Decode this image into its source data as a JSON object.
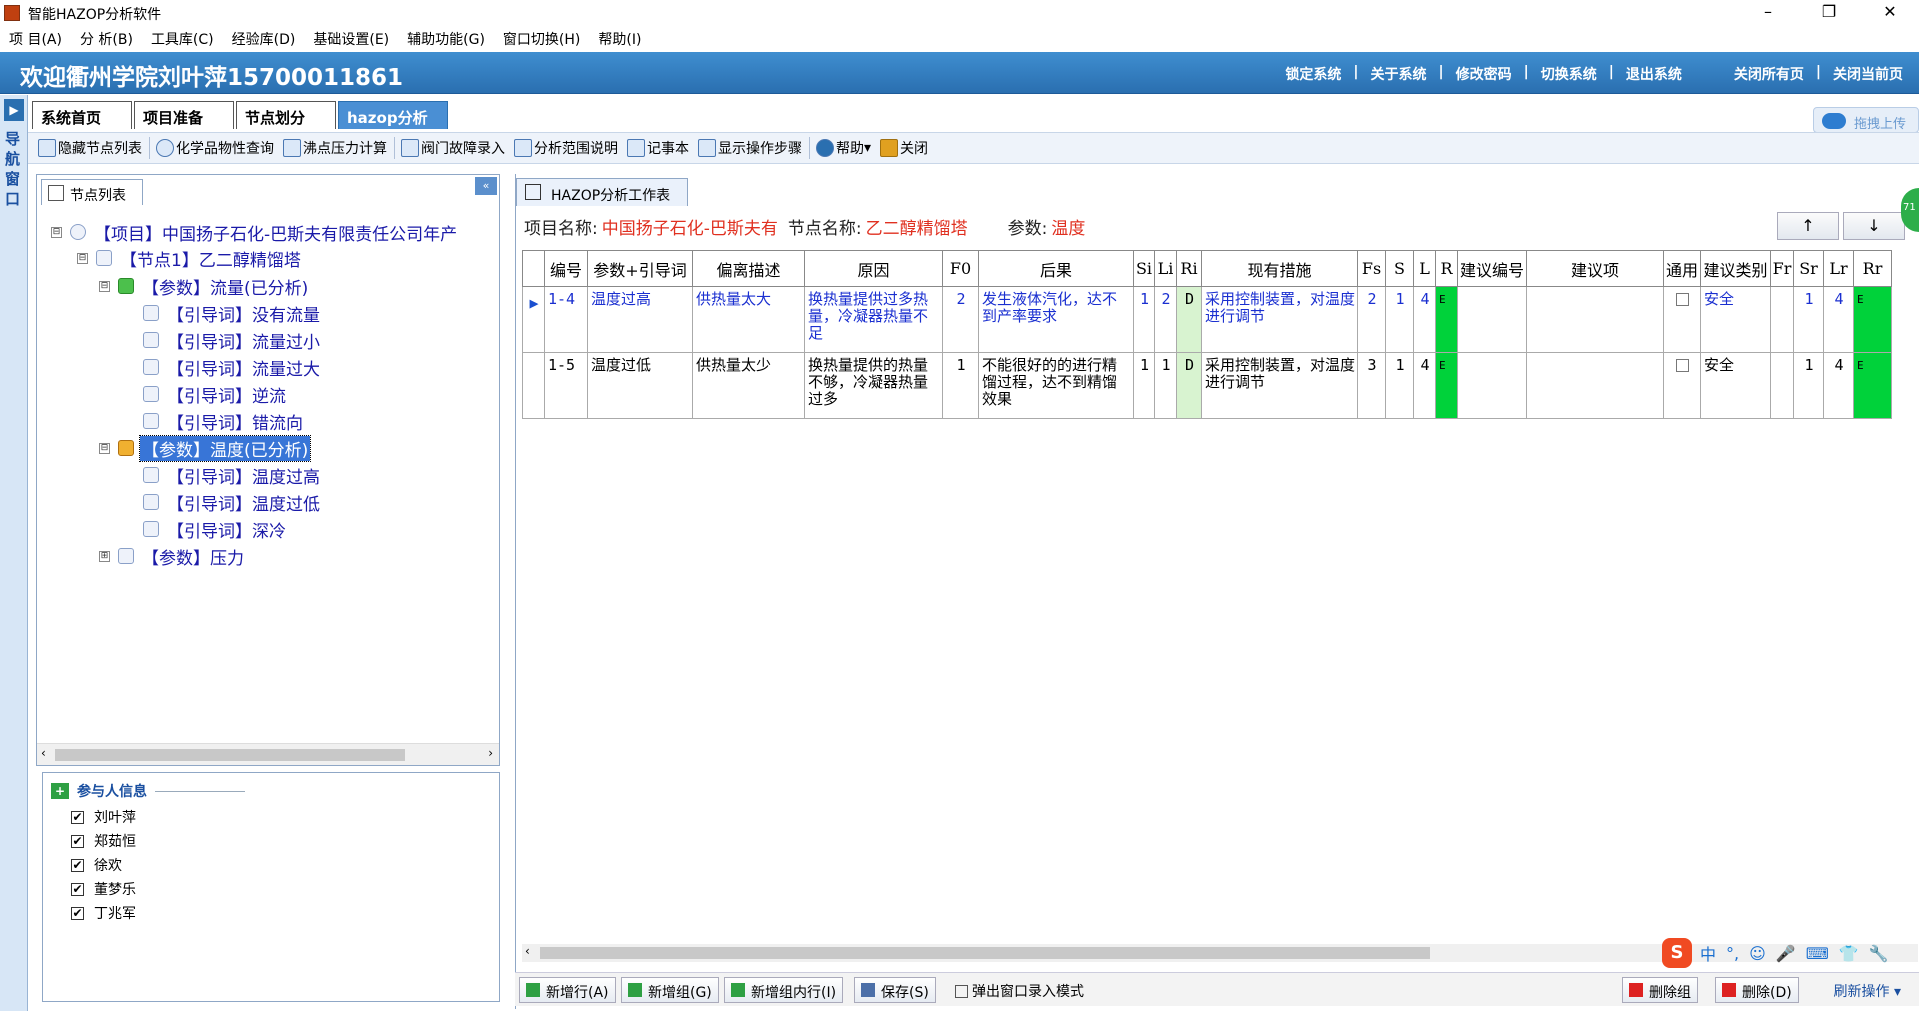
{
  "window": {
    "title": "智能HAZOP分析软件",
    "minimize": "–",
    "restore": "❐",
    "close": "✕"
  },
  "menu": [
    "项 目(A)",
    "分 析(B)",
    "工具库(C)",
    "经验库(D)",
    "基础设置(E)",
    "辅助功能(G)",
    "窗口切换(H)",
    "帮助(I)"
  ],
  "banner": {
    "welcome": "欢迎衢州学院刘叶萍15700011861",
    "links": [
      "锁定系统",
      "关于系统",
      "修改密码",
      "切换系统",
      "退出系统"
    ],
    "right_links": [
      "关闭所有页",
      "关闭当前页"
    ],
    "separator": "|"
  },
  "nav": {
    "label": "导航窗口",
    "arrow": "▶"
  },
  "tabs": [
    {
      "label": "系统首页"
    },
    {
      "label": "项目准备"
    },
    {
      "label": "节点划分"
    },
    {
      "label": "hazop分析",
      "close": "×"
    }
  ],
  "upload": {
    "label": "拖拽上传"
  },
  "toolbar": [
    "隐藏节点列表",
    "化学品物性查询",
    "沸点压力计算",
    "阀门故障录入",
    "分析范围说明",
    "记事本",
    "显示操作步骤",
    "帮助",
    "关闭"
  ],
  "toolbar_help_arrow": "▾",
  "left_panel": {
    "tab": "节点列表",
    "collapse": "«"
  },
  "tree": [
    {
      "text": "【项目】中国扬子石化-巴斯夫有限责任公司年产",
      "exp": "⊟"
    },
    {
      "text": "【节点1】乙二醇精馏塔",
      "exp": "⊟"
    },
    {
      "text": "【参数】流量(已分析)",
      "exp": "⊟"
    },
    {
      "text": "【引导词】没有流量"
    },
    {
      "text": "【引导词】流量过小"
    },
    {
      "text": "【引导词】流量过大"
    },
    {
      "text": "【引导词】逆流"
    },
    {
      "text": "【引导词】错流向"
    },
    {
      "text": "【参数】温度(已分析)",
      "exp": "⊟"
    },
    {
      "text": "【引导词】温度过高"
    },
    {
      "text": "【引导词】温度过低"
    },
    {
      "text": "【引导词】深冷"
    },
    {
      "text": "【参数】压力",
      "exp": "⊞"
    }
  ],
  "scroll": {
    "left": "‹",
    "right": "›"
  },
  "participants": {
    "title": "参与人信息",
    "checkmark": "✔",
    "names": [
      "刘叶萍",
      "郑茹恒",
      "徐欢",
      "董梦乐",
      "丁兆军"
    ]
  },
  "worksheet": {
    "tab": "HAZOP分析工作表",
    "info": {
      "project_label": "项目名称:",
      "project": "中国扬子石化-巴斯夫有",
      "node_label": "节点名称:",
      "node": "乙二醇精馏塔",
      "param_label": "参数:",
      "param": "温度"
    },
    "up": "↑",
    "down": "↓",
    "columns": [
      "编号",
      "参数+引导词",
      "偏离描述",
      "原因",
      "F0",
      "后果",
      "Si",
      "Li",
      "Ri",
      "现有措施",
      "Fs",
      "S",
      "L",
      "R",
      "建议编号",
      "建议项",
      "通用",
      "建议类别",
      "Fr",
      "Sr",
      "Lr",
      "Rr"
    ],
    "rows": [
      {
        "indicator": "▶",
        "id": "1-4",
        "param": "温度过高",
        "deviation": "供热量太大",
        "cause": "换热量提供过多热量，冷凝器热量不足",
        "f0": "2",
        "consequence": "发生液体汽化，达不到产率要求",
        "si": "1",
        "li": "2",
        "ri": "D",
        "measures": "采用控制装置，对温度进行调节",
        "fs": "2",
        "s": "1",
        "l": "4",
        "r": "E",
        "sug_no": "",
        "sug": "",
        "category": "安全",
        "fr": "",
        "sr": "1",
        "lr": "4",
        "rr": "E"
      },
      {
        "indicator": "",
        "id": "1-5",
        "param": "温度过低",
        "deviation": "供热量太少",
        "cause": "换热量提供的热量不够，冷凝器热量过多",
        "f0": "1",
        "consequence": "不能很好的的进行精馏过程，达不到精馏效果",
        "si": "1",
        "li": "1",
        "ri": "D",
        "measures": "采用控制装置，对温度进行调节",
        "fs": "3",
        "s": "1",
        "l": "4",
        "r": "E",
        "sug_no": "",
        "sug": "",
        "category": "安全",
        "fr": "",
        "sr": "1",
        "lr": "4",
        "rr": "E"
      }
    ]
  },
  "bottom": {
    "add_row": "新增行(A)",
    "add_group": "新增组(G)",
    "add_in_group": "新增组内行(I)",
    "save": "保存(S)",
    "popup_mode": "弹出窗口录入模式",
    "delete_group": "删除组",
    "delete": "删除(D)",
    "refresh": "刷新操作 ▾"
  },
  "ime": {
    "logo": "S",
    "items": [
      "中",
      "°,",
      "☺",
      "🎤",
      "⌨",
      "👕",
      "🔧"
    ]
  },
  "badge": "71"
}
